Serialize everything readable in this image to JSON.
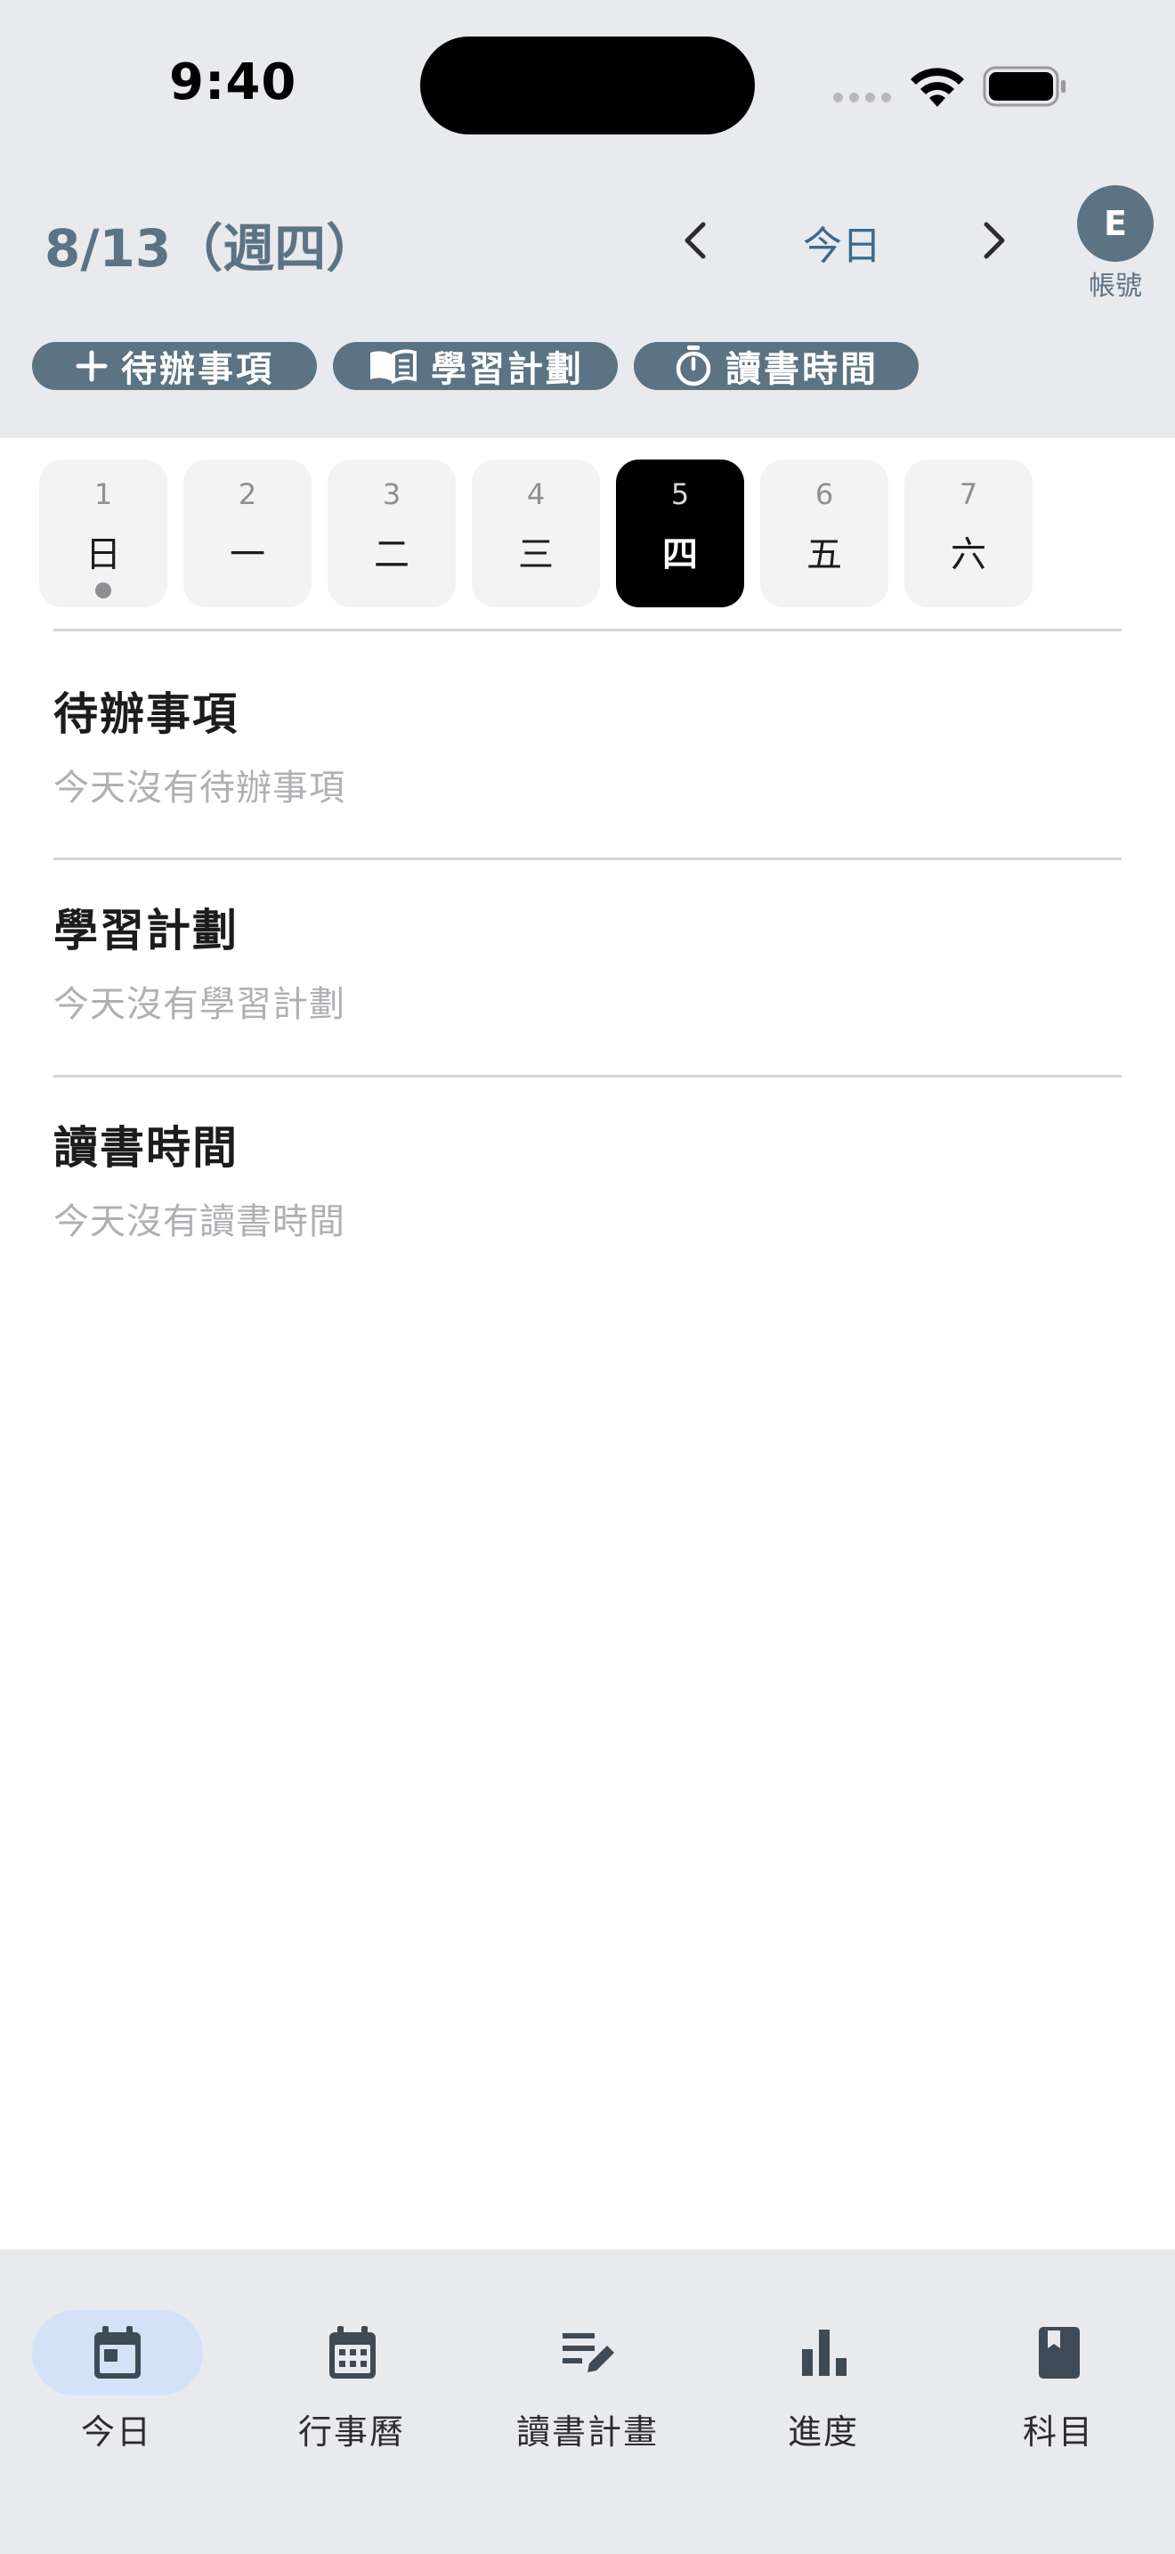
{
  "status_bar": {
    "time": "9:40"
  },
  "header": {
    "date_title": "8/13（週四）",
    "today_label": "今日",
    "avatar_initial": "E",
    "account_label": "帳號"
  },
  "quick_actions": [
    {
      "label": "待辦事項",
      "icon": "plus-icon"
    },
    {
      "label": "學習計劃",
      "icon": "book-open-icon"
    },
    {
      "label": "讀書時間",
      "icon": "stopwatch-icon"
    }
  ],
  "week": [
    {
      "num": "1",
      "weekday": "日",
      "has_event": true
    },
    {
      "num": "2",
      "weekday": "一"
    },
    {
      "num": "3",
      "weekday": "二"
    },
    {
      "num": "4",
      "weekday": "三"
    },
    {
      "num": "5",
      "weekday": "四",
      "selected": true
    },
    {
      "num": "6",
      "weekday": "五"
    },
    {
      "num": "7",
      "weekday": "六"
    }
  ],
  "sections": [
    {
      "title": "待辦事項",
      "empty": "今天沒有待辦事項"
    },
    {
      "title": "學習計劃",
      "empty": "今天沒有學習計劃"
    },
    {
      "title": "讀書時間",
      "empty": "今天沒有讀書時間"
    }
  ],
  "tabs": [
    {
      "label": "今日",
      "icon": "calendar-today-icon",
      "active": true
    },
    {
      "label": "行事曆",
      "icon": "calendar-month-icon"
    },
    {
      "label": "讀書計畫",
      "icon": "edit-note-icon"
    },
    {
      "label": "進度",
      "icon": "bar-chart-icon"
    },
    {
      "label": "科目",
      "icon": "bookmark-book-icon"
    }
  ],
  "colors": {
    "accent": "#5b7383",
    "header_bg": "#e9eaee",
    "active_tab_pill": "#d3e2f7",
    "selected_day": "#000000"
  }
}
